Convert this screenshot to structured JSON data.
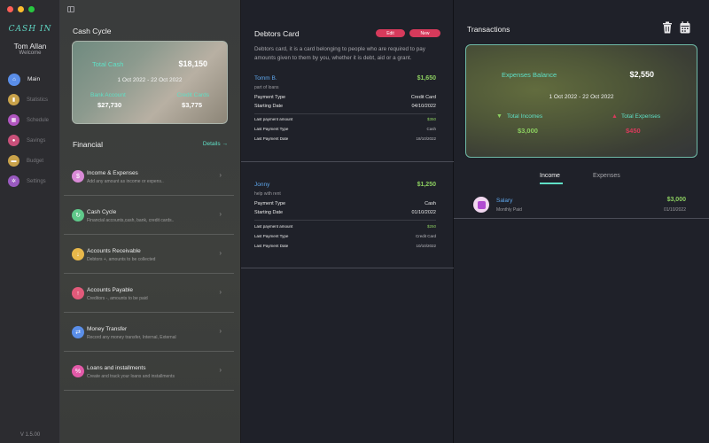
{
  "sidebar": {
    "logo": "CASH IN",
    "user_name": "Tom Allan",
    "welcome": "Welcome",
    "version": "V 1.5.00",
    "items": [
      {
        "label": "Main",
        "icon": "home-icon",
        "color": "#5a8ee8",
        "active": true
      },
      {
        "label": "Statistics",
        "icon": "chart-icon",
        "color": "#e8b84a"
      },
      {
        "label": "Schedule",
        "icon": "calendar-icon",
        "color": "#c95ad6"
      },
      {
        "label": "Savings",
        "icon": "piggy-bank-icon",
        "color": "#e25a8a"
      },
      {
        "label": "Budget",
        "icon": "wallet-icon",
        "color": "#e0b64a"
      },
      {
        "label": "Settings",
        "icon": "gear-icon",
        "color": "#b06ad6"
      }
    ]
  },
  "cash_cycle": {
    "title": "Cash Cycle",
    "total_label": "Total Cash",
    "total_value": "$18,150",
    "date_range": "1 Oct 2022 - 22 Oct 2022",
    "bank_label": "Bank Account",
    "bank_value": "$27,730",
    "credit_label": "Credit Cards",
    "credit_value": "$3,775"
  },
  "financial": {
    "title": "Financial",
    "details_link": "Details →",
    "items": [
      {
        "title": "Income & Expenses",
        "subtitle": "Add any amount as income or expens..",
        "color": "#d98ad6",
        "glyph": "$"
      },
      {
        "title": "Cash Cycle",
        "subtitle": "Financial accounts,cash, bank, credit cards..",
        "color": "#5fc98a",
        "glyph": "↻"
      },
      {
        "title": "Accounts Receivable",
        "subtitle": "Debtors +, amounts to be collected",
        "color": "#e8b84a",
        "glyph": "↓"
      },
      {
        "title": "Accounts Payable",
        "subtitle": "Creditors -, amounts to be paid",
        "color": "#e25a7a",
        "glyph": "↑"
      },
      {
        "title": "Money Transfer",
        "subtitle": "Record any money transfer, Internal, External",
        "color": "#5a8ee8",
        "glyph": "⇄"
      },
      {
        "title": "Loans and installments",
        "subtitle": "Create and track your loans and installments",
        "color": "#e25aa8",
        "glyph": "%"
      }
    ]
  },
  "debtors": {
    "title": "Debtors Card",
    "edit_label": "Edit",
    "new_label": "New",
    "description": "Debtors card, it is a card belonging to people who are required to pay amounts given to them by you, whether it is debt, aid or a grant.",
    "entries": [
      {
        "name": "Tomm B.",
        "amount": "$1,650",
        "note": "part of loans",
        "payment_type_label": "Payment Type",
        "payment_type": "Credit Card",
        "starting_date_label": "Starting Date",
        "starting_date": "04/10/2022",
        "last_amount_label": "Last payment amount",
        "last_amount": "$350",
        "last_type_label": "Last Payment Type",
        "last_type": "Cash",
        "last_date_label": "Last Payment Date",
        "last_date": "18/10/2022"
      },
      {
        "name": "Jonny",
        "amount": "$1,250",
        "note": "help with rent",
        "payment_type_label": "Payment Type",
        "payment_type": "Cash",
        "starting_date_label": "Starting Date",
        "starting_date": "01/10/2022",
        "last_amount_label": "Last payment amount",
        "last_amount": "$250",
        "last_type_label": "Last Payment Type",
        "last_type": "Credit Card",
        "last_date_label": "Last Payment Date",
        "last_date": "10/10/2022"
      }
    ]
  },
  "transactions": {
    "title": "Transactions",
    "balance_label": "Expenses Balance",
    "balance_value": "$2,550",
    "date_range": "1 Oct 2022 - 22 Oct 2022",
    "incomes_label": "Total Incomes",
    "incomes_value": "$3,000",
    "expenses_label": "Total Expenses",
    "expenses_value": "$450",
    "tabs": [
      "Income",
      "Expenses"
    ],
    "list": [
      {
        "name": "Salary",
        "sub": "Monthly Paid",
        "amount": "$3,000",
        "date": "01/10/2022"
      }
    ]
  }
}
